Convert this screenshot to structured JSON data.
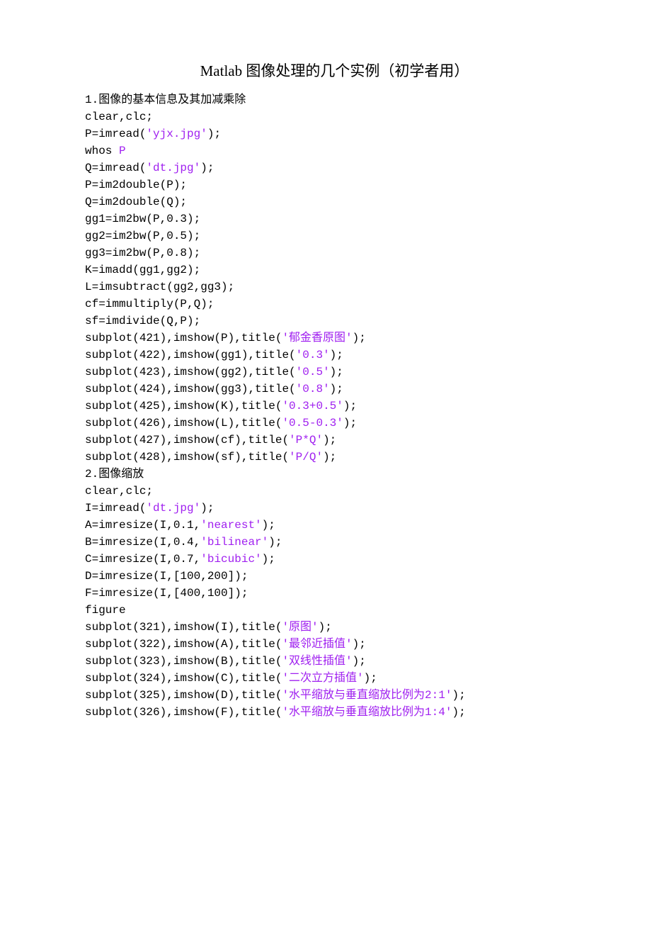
{
  "title": "Matlab 图像处理的几个实例（初学者用）",
  "sections": {
    "s1": {
      "heading": "1.图像的基本信息及其加减乘除",
      "lines": {
        "l1": "clear,clc;",
        "l2a": "P=imread(",
        "l2b": "'yjx.jpg'",
        "l2c": ");",
        "l3a": "whos ",
        "l3b": "P",
        "l4a": "Q=imread(",
        "l4b": "'dt.jpg'",
        "l4c": ");",
        "l5": "P=im2double(P);",
        "l6": "Q=im2double(Q);",
        "l7": "gg1=im2bw(P,0.3);",
        "l8": "gg2=im2bw(P,0.5);",
        "l9": "gg3=im2bw(P,0.8);",
        "l10": "K=imadd(gg1,gg2);",
        "l11": "L=imsubtract(gg2,gg3);",
        "l12": "cf=immultiply(P,Q);",
        "l13": "sf=imdivide(Q,P);",
        "l14a": "subplot(421),imshow(P),title(",
        "l14b": "'郁金香原图'",
        "l14c": ");",
        "l15a": "subplot(422),imshow(gg1),title(",
        "l15b": "'0.3'",
        "l15c": ");",
        "l16a": "subplot(423),imshow(gg2),title(",
        "l16b": "'0.5'",
        "l16c": ");",
        "l17a": "subplot(424),imshow(gg3),title(",
        "l17b": "'0.8'",
        "l17c": ");",
        "l18a": "subplot(425),imshow(K),title(",
        "l18b": "'0.3+0.5'",
        "l18c": ");",
        "l19a": "subplot(426),imshow(L),title(",
        "l19b": "'0.5-0.3'",
        "l19c": ");",
        "l20a": "subplot(427),imshow(cf),title(",
        "l20b": "'P*Q'",
        "l20c": ");",
        "l21a": "subplot(428),imshow(sf),title(",
        "l21b": "'P/Q'",
        "l21c": ");"
      }
    },
    "s2": {
      "heading": "2.图像缩放",
      "lines": {
        "l1": "clear,clc;",
        "l2a": "I=imread(",
        "l2b": "'dt.jpg'",
        "l2c": ");",
        "l3a": "A=imresize(I,0.1,",
        "l3b": "'nearest'",
        "l3c": ");",
        "l4a": "B=imresize(I,0.4,",
        "l4b": "'bilinear'",
        "l4c": ");",
        "l5a": "C=imresize(I,0.7,",
        "l5b": "'bicubic'",
        "l5c": ");",
        "l6": "D=imresize(I,[100,200]);",
        "l7": "F=imresize(I,[400,100]);",
        "l8": "figure",
        "l9a": "subplot(321),imshow(I),title(",
        "l9b": "'原图'",
        "l9c": ");",
        "l10a": "subplot(322),imshow(A),title(",
        "l10b": "'最邻近插值'",
        "l10c": ");",
        "l11a": "subplot(323),imshow(B),title(",
        "l11b": "'双线性插值'",
        "l11c": ");",
        "l12a": "subplot(324),imshow(C),title(",
        "l12b": "'二次立方插值'",
        "l12c": ");",
        "l13a": "subplot(325),imshow(D),title(",
        "l13b": "'水平缩放与垂直缩放比例为2:1'",
        "l13c": ");",
        "l14a": "subplot(326),imshow(F),title(",
        "l14b": "'水平缩放与垂直缩放比例为1:4'",
        "l14c": ");"
      }
    }
  }
}
